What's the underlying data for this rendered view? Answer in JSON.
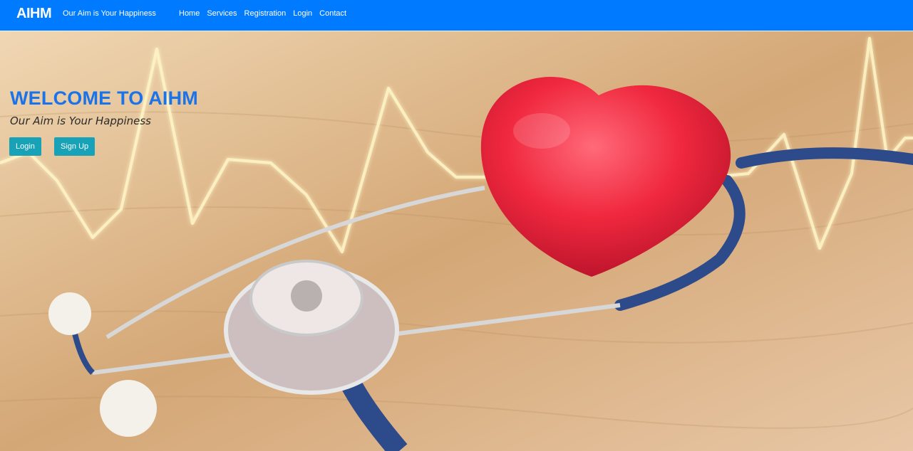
{
  "navbar": {
    "brand": "AIHM",
    "tagline": "Our Aim is Your Happiness",
    "links": [
      "Home",
      "Services",
      "Registration",
      "Login",
      "Contact"
    ]
  },
  "hero": {
    "title": "WELCOME TO AIHM",
    "subtitle": "Our Aim is Your Happiness",
    "buttons": {
      "login": "Login",
      "signup": "Sign Up"
    },
    "image": "heart-and-stethoscope-on-wooden-table"
  },
  "colors": {
    "navbar": "#007bff",
    "title": "#1a73e8",
    "button": "#17a2b8"
  }
}
